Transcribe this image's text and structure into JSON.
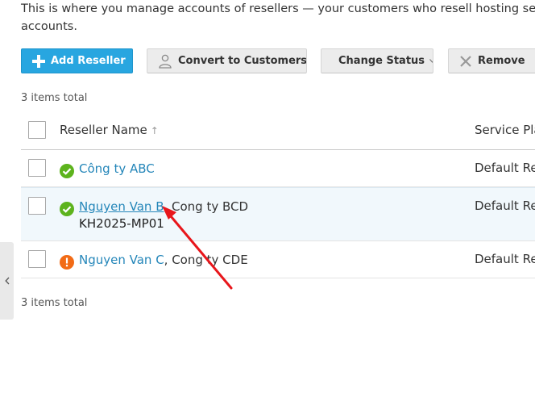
{
  "intro_text": "This is where you manage accounts of resellers — your customers who resell hosting services, and accounts.",
  "intro_line1": "This is where you manage accounts of resellers — your customers who resell hosting serv",
  "intro_line2": "accounts.",
  "toolbar": {
    "add_reseller": "Add Reseller",
    "convert_to_customers": "Convert to Customers",
    "change_status": "Change Status",
    "remove": "Remove"
  },
  "items_total_top": "3 items total",
  "items_total_bottom": "3 items total",
  "table": {
    "columns": [
      "Reseller Name",
      "Service Pla"
    ],
    "sort_indicator": "↑",
    "rows": [
      {
        "name": "Công ty ABC",
        "company": "",
        "extra": "",
        "status": "ok",
        "plan": "Default Re"
      },
      {
        "name": "Nguyen Van B",
        "company": ", Cong ty BCD",
        "extra": "KH2025-MP01",
        "status": "ok",
        "plan": "Default Re"
      },
      {
        "name": "Nguyen Van C",
        "company": ", Cong ty CDE",
        "extra": "",
        "status": "warning",
        "plan": "Default Re"
      }
    ]
  },
  "colors": {
    "primary": "#28a6e0",
    "link": "#2486b9",
    "status_ok": "#5db31d",
    "status_warning": "#f26b16",
    "annotation_arrow": "#e8161b"
  }
}
